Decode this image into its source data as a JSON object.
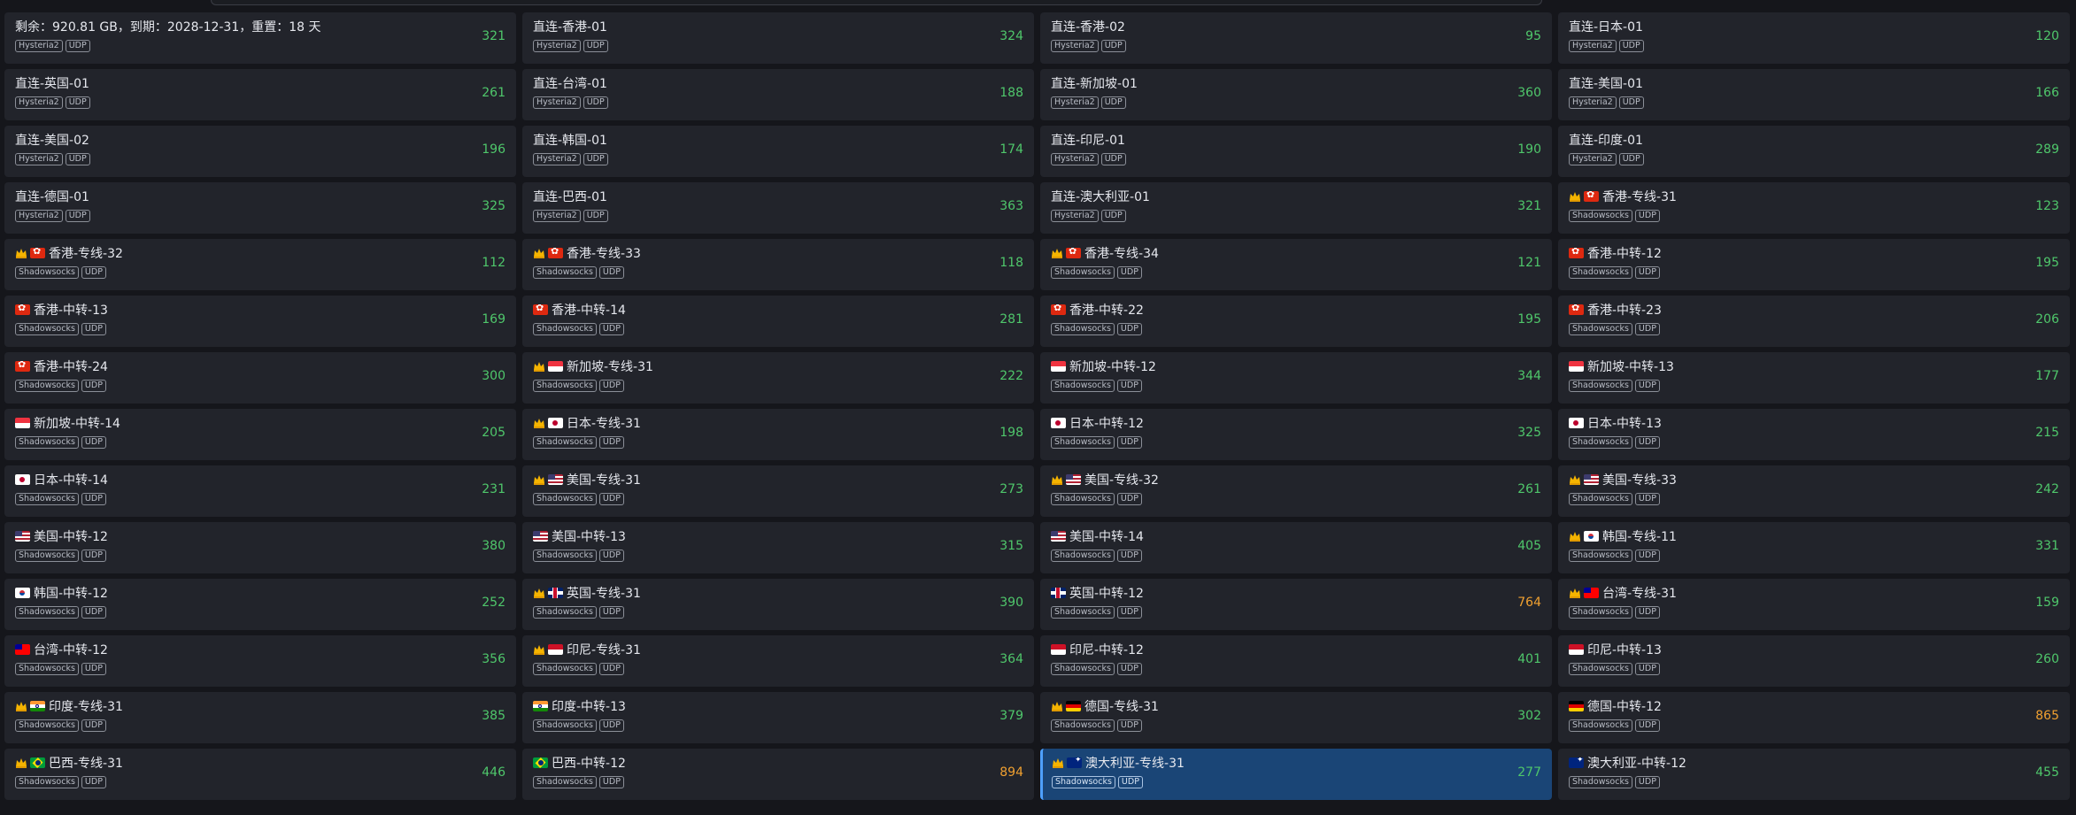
{
  "colors": {
    "latency_good": "#4fc76b",
    "latency_warn": "#f0a030",
    "selected_bg": "#1a4576",
    "card_bg": "#22242b"
  },
  "nodes": [
    {
      "name": "剩余：920.81 GB，到期：2028-12-31，重置：18 天",
      "protocol": "Hysteria2",
      "transport": "UDP",
      "latency": "321",
      "crown": false,
      "flag": "",
      "warn": false,
      "selected": false
    },
    {
      "name": "直连-香港-01",
      "protocol": "Hysteria2",
      "transport": "UDP",
      "latency": "324",
      "crown": false,
      "flag": "",
      "warn": false,
      "selected": false
    },
    {
      "name": "直连-香港-02",
      "protocol": "Hysteria2",
      "transport": "UDP",
      "latency": "95",
      "crown": false,
      "flag": "",
      "warn": false,
      "selected": false
    },
    {
      "name": "直连-日本-01",
      "protocol": "Hysteria2",
      "transport": "UDP",
      "latency": "120",
      "crown": false,
      "flag": "",
      "warn": false,
      "selected": false
    },
    {
      "name": "直连-英国-01",
      "protocol": "Hysteria2",
      "transport": "UDP",
      "latency": "261",
      "crown": false,
      "flag": "",
      "warn": false,
      "selected": false
    },
    {
      "name": "直连-台湾-01",
      "protocol": "Hysteria2",
      "transport": "UDP",
      "latency": "188",
      "crown": false,
      "flag": "",
      "warn": false,
      "selected": false
    },
    {
      "name": "直连-新加坡-01",
      "protocol": "Hysteria2",
      "transport": "UDP",
      "latency": "360",
      "crown": false,
      "flag": "",
      "warn": false,
      "selected": false
    },
    {
      "name": "直连-美国-01",
      "protocol": "Hysteria2",
      "transport": "UDP",
      "latency": "166",
      "crown": false,
      "flag": "",
      "warn": false,
      "selected": false
    },
    {
      "name": "直连-美国-02",
      "protocol": "Hysteria2",
      "transport": "UDP",
      "latency": "196",
      "crown": false,
      "flag": "",
      "warn": false,
      "selected": false
    },
    {
      "name": "直连-韩国-01",
      "protocol": "Hysteria2",
      "transport": "UDP",
      "latency": "174",
      "crown": false,
      "flag": "",
      "warn": false,
      "selected": false
    },
    {
      "name": "直连-印尼-01",
      "protocol": "Hysteria2",
      "transport": "UDP",
      "latency": "190",
      "crown": false,
      "flag": "",
      "warn": false,
      "selected": false
    },
    {
      "name": "直连-印度-01",
      "protocol": "Hysteria2",
      "transport": "UDP",
      "latency": "289",
      "crown": false,
      "flag": "",
      "warn": false,
      "selected": false
    },
    {
      "name": "直连-德国-01",
      "protocol": "Hysteria2",
      "transport": "UDP",
      "latency": "325",
      "crown": false,
      "flag": "",
      "warn": false,
      "selected": false
    },
    {
      "name": "直连-巴西-01",
      "protocol": "Hysteria2",
      "transport": "UDP",
      "latency": "363",
      "crown": false,
      "flag": "",
      "warn": false,
      "selected": false
    },
    {
      "name": "直连-澳大利亚-01",
      "protocol": "Hysteria2",
      "transport": "UDP",
      "latency": "321",
      "crown": false,
      "flag": "",
      "warn": false,
      "selected": false
    },
    {
      "name": "香港-专线-31",
      "protocol": "Shadowsocks",
      "transport": "UDP",
      "latency": "123",
      "crown": true,
      "flag": "hk",
      "warn": false,
      "selected": false
    },
    {
      "name": "香港-专线-32",
      "protocol": "Shadowsocks",
      "transport": "UDP",
      "latency": "112",
      "crown": true,
      "flag": "hk",
      "warn": false,
      "selected": false
    },
    {
      "name": "香港-专线-33",
      "protocol": "Shadowsocks",
      "transport": "UDP",
      "latency": "118",
      "crown": true,
      "flag": "hk",
      "warn": false,
      "selected": false
    },
    {
      "name": "香港-专线-34",
      "protocol": "Shadowsocks",
      "transport": "UDP",
      "latency": "121",
      "crown": true,
      "flag": "hk",
      "warn": false,
      "selected": false
    },
    {
      "name": "香港-中转-12",
      "protocol": "Shadowsocks",
      "transport": "UDP",
      "latency": "195",
      "crown": false,
      "flag": "hk",
      "warn": false,
      "selected": false
    },
    {
      "name": "香港-中转-13",
      "protocol": "Shadowsocks",
      "transport": "UDP",
      "latency": "169",
      "crown": false,
      "flag": "hk",
      "warn": false,
      "selected": false
    },
    {
      "name": "香港-中转-14",
      "protocol": "Shadowsocks",
      "transport": "UDP",
      "latency": "281",
      "crown": false,
      "flag": "hk",
      "warn": false,
      "selected": false
    },
    {
      "name": "香港-中转-22",
      "protocol": "Shadowsocks",
      "transport": "UDP",
      "latency": "195",
      "crown": false,
      "flag": "hk",
      "warn": false,
      "selected": false
    },
    {
      "name": "香港-中转-23",
      "protocol": "Shadowsocks",
      "transport": "UDP",
      "latency": "206",
      "crown": false,
      "flag": "hk",
      "warn": false,
      "selected": false
    },
    {
      "name": "香港-中转-24",
      "protocol": "Shadowsocks",
      "transport": "UDP",
      "latency": "300",
      "crown": false,
      "flag": "hk",
      "warn": false,
      "selected": false
    },
    {
      "name": "新加坡-专线-31",
      "protocol": "Shadowsocks",
      "transport": "UDP",
      "latency": "222",
      "crown": true,
      "flag": "sg",
      "warn": false,
      "selected": false
    },
    {
      "name": "新加坡-中转-12",
      "protocol": "Shadowsocks",
      "transport": "UDP",
      "latency": "344",
      "crown": false,
      "flag": "sg",
      "warn": false,
      "selected": false
    },
    {
      "name": "新加坡-中转-13",
      "protocol": "Shadowsocks",
      "transport": "UDP",
      "latency": "177",
      "crown": false,
      "flag": "sg",
      "warn": false,
      "selected": false
    },
    {
      "name": "新加坡-中转-14",
      "protocol": "Shadowsocks",
      "transport": "UDP",
      "latency": "205",
      "crown": false,
      "flag": "sg",
      "warn": false,
      "selected": false
    },
    {
      "name": "日本-专线-31",
      "protocol": "Shadowsocks",
      "transport": "UDP",
      "latency": "198",
      "crown": true,
      "flag": "jp",
      "warn": false,
      "selected": false
    },
    {
      "name": "日本-中转-12",
      "protocol": "Shadowsocks",
      "transport": "UDP",
      "latency": "325",
      "crown": false,
      "flag": "jp",
      "warn": false,
      "selected": false
    },
    {
      "name": "日本-中转-13",
      "protocol": "Shadowsocks",
      "transport": "UDP",
      "latency": "215",
      "crown": false,
      "flag": "jp",
      "warn": false,
      "selected": false
    },
    {
      "name": "日本-中转-14",
      "protocol": "Shadowsocks",
      "transport": "UDP",
      "latency": "231",
      "crown": false,
      "flag": "jp",
      "warn": false,
      "selected": false
    },
    {
      "name": "美国-专线-31",
      "protocol": "Shadowsocks",
      "transport": "UDP",
      "latency": "273",
      "crown": true,
      "flag": "us",
      "warn": false,
      "selected": false
    },
    {
      "name": "美国-专线-32",
      "protocol": "Shadowsocks",
      "transport": "UDP",
      "latency": "261",
      "crown": true,
      "flag": "us",
      "warn": false,
      "selected": false
    },
    {
      "name": "美国-专线-33",
      "protocol": "Shadowsocks",
      "transport": "UDP",
      "latency": "242",
      "crown": true,
      "flag": "us",
      "warn": false,
      "selected": false
    },
    {
      "name": "美国-中转-12",
      "protocol": "Shadowsocks",
      "transport": "UDP",
      "latency": "380",
      "crown": false,
      "flag": "us",
      "warn": false,
      "selected": false
    },
    {
      "name": "美国-中转-13",
      "protocol": "Shadowsocks",
      "transport": "UDP",
      "latency": "315",
      "crown": false,
      "flag": "us",
      "warn": false,
      "selected": false
    },
    {
      "name": "美国-中转-14",
      "protocol": "Shadowsocks",
      "transport": "UDP",
      "latency": "405",
      "crown": false,
      "flag": "us",
      "warn": false,
      "selected": false
    },
    {
      "name": "韩国-专线-11",
      "protocol": "Shadowsocks",
      "transport": "UDP",
      "latency": "331",
      "crown": true,
      "flag": "kr",
      "warn": false,
      "selected": false
    },
    {
      "name": "韩国-中转-12",
      "protocol": "Shadowsocks",
      "transport": "UDP",
      "latency": "252",
      "crown": false,
      "flag": "kr",
      "warn": false,
      "selected": false
    },
    {
      "name": "英国-专线-31",
      "protocol": "Shadowsocks",
      "transport": "UDP",
      "latency": "390",
      "crown": true,
      "flag": "gb",
      "warn": false,
      "selected": false
    },
    {
      "name": "英国-中转-12",
      "protocol": "Shadowsocks",
      "transport": "UDP",
      "latency": "764",
      "crown": false,
      "flag": "gb",
      "warn": true,
      "selected": false
    },
    {
      "name": "台湾-专线-31",
      "protocol": "Shadowsocks",
      "transport": "UDP",
      "latency": "159",
      "crown": true,
      "flag": "tw",
      "warn": false,
      "selected": false
    },
    {
      "name": "台湾-中转-12",
      "protocol": "Shadowsocks",
      "transport": "UDP",
      "latency": "356",
      "crown": false,
      "flag": "tw",
      "warn": false,
      "selected": false
    },
    {
      "name": "印尼-专线-31",
      "protocol": "Shadowsocks",
      "transport": "UDP",
      "latency": "364",
      "crown": true,
      "flag": "id",
      "warn": false,
      "selected": false
    },
    {
      "name": "印尼-中转-12",
      "protocol": "Shadowsocks",
      "transport": "UDP",
      "latency": "401",
      "crown": false,
      "flag": "id",
      "warn": false,
      "selected": false
    },
    {
      "name": "印尼-中转-13",
      "protocol": "Shadowsocks",
      "transport": "UDP",
      "latency": "260",
      "crown": false,
      "flag": "id",
      "warn": false,
      "selected": false
    },
    {
      "name": "印度-专线-31",
      "protocol": "Shadowsocks",
      "transport": "UDP",
      "latency": "385",
      "crown": true,
      "flag": "in",
      "warn": false,
      "selected": false
    },
    {
      "name": "印度-中转-13",
      "protocol": "Shadowsocks",
      "transport": "UDP",
      "latency": "379",
      "crown": false,
      "flag": "in",
      "warn": false,
      "selected": false
    },
    {
      "name": "德国-专线-31",
      "protocol": "Shadowsocks",
      "transport": "UDP",
      "latency": "302",
      "crown": true,
      "flag": "de",
      "warn": false,
      "selected": false
    },
    {
      "name": "德国-中转-12",
      "protocol": "Shadowsocks",
      "transport": "UDP",
      "latency": "865",
      "crown": false,
      "flag": "de",
      "warn": true,
      "selected": false
    },
    {
      "name": "巴西-专线-31",
      "protocol": "Shadowsocks",
      "transport": "UDP",
      "latency": "446",
      "crown": true,
      "flag": "br",
      "warn": false,
      "selected": false
    },
    {
      "name": "巴西-中转-12",
      "protocol": "Shadowsocks",
      "transport": "UDP",
      "latency": "894",
      "crown": false,
      "flag": "br",
      "warn": true,
      "selected": false
    },
    {
      "name": "澳大利亚-专线-31",
      "protocol": "Shadowsocks",
      "transport": "UDP",
      "latency": "277",
      "crown": true,
      "flag": "au",
      "warn": false,
      "selected": true
    },
    {
      "name": "澳大利亚-中转-12",
      "protocol": "Shadowsocks",
      "transport": "UDP",
      "latency": "455",
      "crown": false,
      "flag": "au",
      "warn": false,
      "selected": false
    }
  ]
}
